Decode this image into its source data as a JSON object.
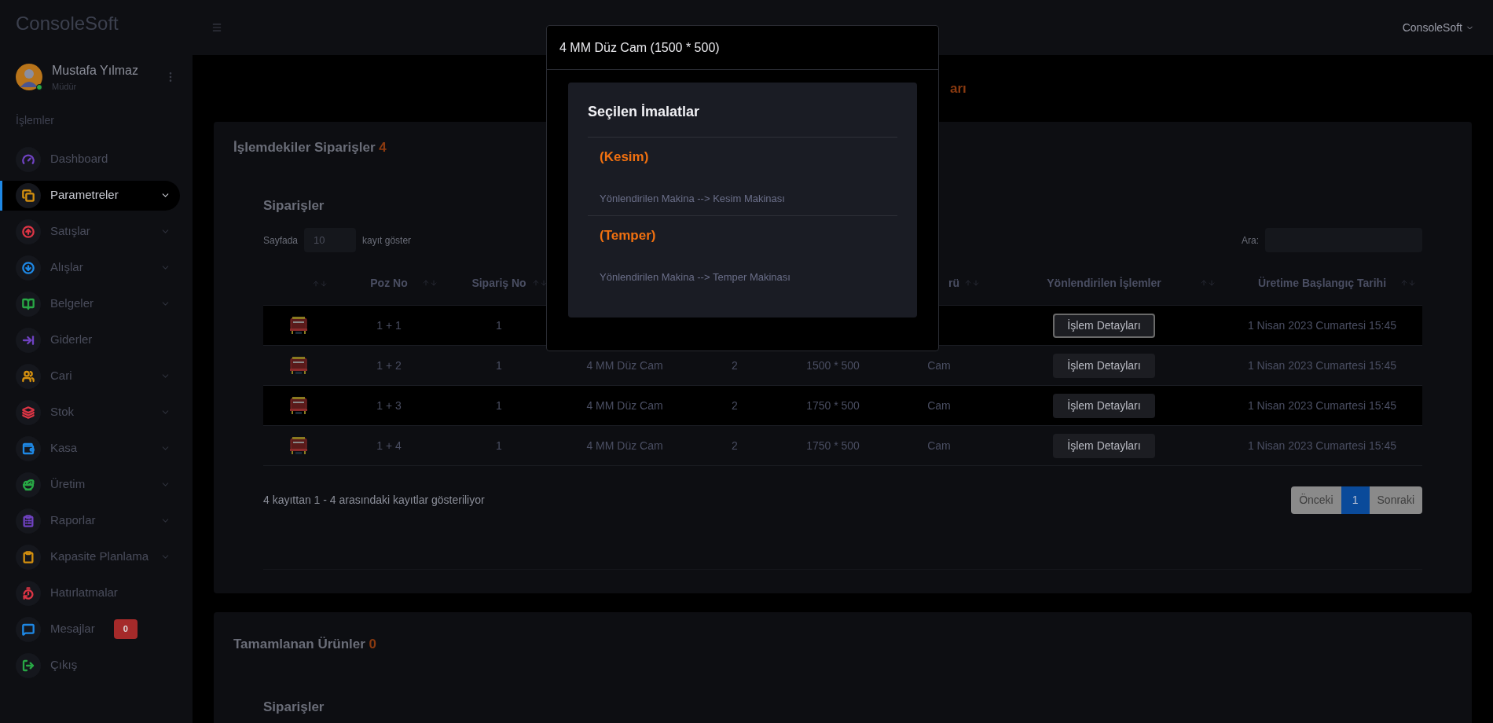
{
  "brand": "ConsoleSoft",
  "topbar": {
    "user_menu": "ConsoleSoft"
  },
  "user": {
    "name": "Mustafa Yılmaz",
    "role": "Müdür",
    "online": true
  },
  "sidebar": {
    "heading": "İşlemler",
    "items": [
      {
        "label": "Dashboard",
        "color": "#6f42c1",
        "expandable": false,
        "selected": false
      },
      {
        "label": "Parametreler",
        "color": "#d4900f",
        "expandable": true,
        "selected": true
      },
      {
        "label": "Satışlar",
        "color": "#dc3545",
        "expandable": true,
        "selected": false
      },
      {
        "label": "Alışlar",
        "color": "#1e88e5",
        "expandable": true,
        "selected": false
      },
      {
        "label": "Belgeler",
        "color": "#28a745",
        "expandable": true,
        "selected": false
      },
      {
        "label": "Giderler",
        "color": "#6f42c1",
        "expandable": false,
        "selected": false
      },
      {
        "label": "Cari",
        "color": "#d4900f",
        "expandable": true,
        "selected": false
      },
      {
        "label": "Stok",
        "color": "#dc3545",
        "expandable": true,
        "selected": false
      },
      {
        "label": "Kasa",
        "color": "#1e88e5",
        "expandable": true,
        "selected": false
      },
      {
        "label": "Üretim",
        "color": "#28a745",
        "expandable": true,
        "selected": false
      },
      {
        "label": "Raporlar",
        "color": "#6f42c1",
        "expandable": true,
        "selected": false
      },
      {
        "label": "Kapasite Planlama",
        "color": "#d4900f",
        "expandable": true,
        "selected": false
      },
      {
        "label": "Hatırlatmalar",
        "color": "#dc3545",
        "expandable": false,
        "selected": false
      },
      {
        "label": "Mesajlar",
        "color": "#1e88e5",
        "expandable": false,
        "selected": false,
        "badge": "0"
      },
      {
        "label": "Çıkış",
        "color": "#28a745",
        "expandable": false,
        "selected": false
      }
    ]
  },
  "page_heading": "arı",
  "cards": [
    {
      "title": "İşlemdekiler Siparişler",
      "count": "4",
      "subtitle": "Siparişler",
      "length_label_before": "Sayfada",
      "length_value": "10",
      "length_label_after": "kayıt göster",
      "search_label": "Ara:",
      "columns": [
        {
          "kind": "image"
        },
        {
          "kind": "text",
          "label": "Poz No"
        },
        {
          "kind": "text",
          "label": "Sipariş No"
        },
        {
          "kind": "hidden"
        },
        {
          "kind": "hidden"
        },
        {
          "kind": "hidden"
        },
        {
          "kind": "text",
          "label": "rü"
        },
        {
          "kind": "text",
          "label": "Yönlendirilen İşlemler"
        },
        {
          "kind": "text",
          "label": "Üretime Başlangıç Tarihi"
        }
      ],
      "rows": [
        {
          "cells": [
            null,
            "1 + 1",
            "1",
            null,
            null,
            null,
            null
          ],
          "button": "İşlem Detayları",
          "focused": true,
          "date": "1 Nisan 2023 Cumartesi 15:45"
        },
        {
          "cells": [
            null,
            "1 + 2",
            "1",
            "4 MM Düz Cam",
            "2",
            "1500 * 500",
            "Cam"
          ],
          "button": "İşlem Detayları",
          "focused": false,
          "date": "1 Nisan 2023 Cumartesi 15:45"
        },
        {
          "cells": [
            null,
            "1 + 3",
            "1",
            "4 MM Düz Cam",
            "2",
            "1750 * 500",
            "Cam"
          ],
          "button": "İşlem Detayları",
          "focused": false,
          "date": "1 Nisan 2023 Cumartesi 15:45"
        },
        {
          "cells": [
            null,
            "1 + 4",
            "1",
            "4 MM Düz Cam",
            "2",
            "1750 * 500",
            "Cam"
          ],
          "button": "İşlem Detayları",
          "focused": false,
          "date": "1 Nisan 2023 Cumartesi 15:45"
        }
      ],
      "info": "4 kayıttan 1 - 4 arasındaki kayıtlar gösteriliyor",
      "pagination": [
        {
          "label": "Önceki",
          "selected": false,
          "disabled": true
        },
        {
          "label": "1",
          "selected": true,
          "disabled": false
        },
        {
          "label": "Sonraki",
          "selected": false,
          "disabled": true
        }
      ]
    },
    {
      "title": "Tamamlanan Ürünler",
      "count": "0",
      "subtitle": "Siparişler"
    }
  ],
  "modal": {
    "title": "4 MM Düz Cam (1500 * 500)",
    "panel_title": "Seçilen İmalatlar",
    "sections": [
      {
        "title": "(Kesim)",
        "text": "Yönlendirilen Makina --> Kesim Makinası"
      },
      {
        "title": "(Temper)",
        "text": "Yönlendirilen Makina --> Temper Makinası"
      }
    ]
  }
}
